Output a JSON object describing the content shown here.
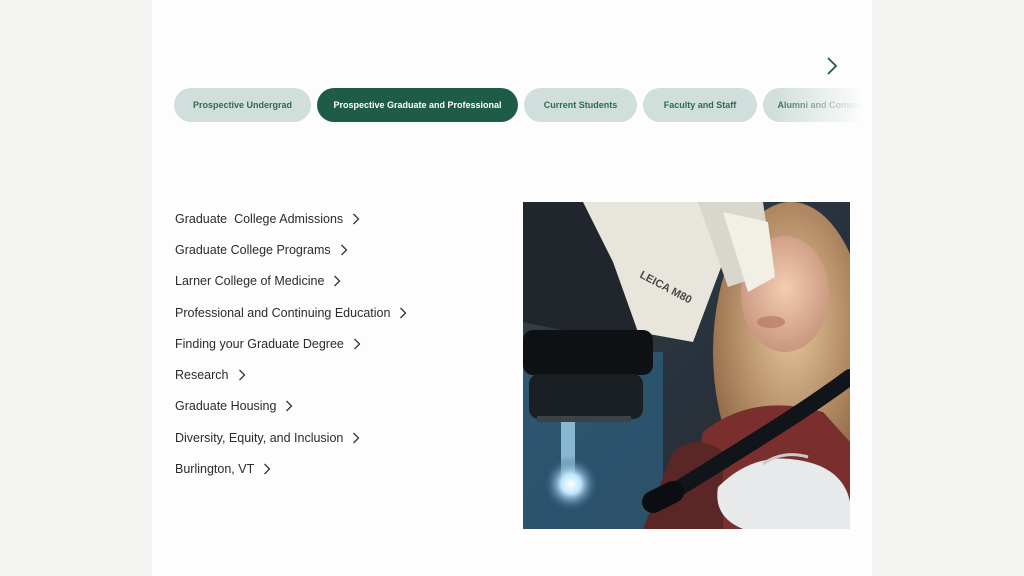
{
  "tabs": [
    {
      "label": "Prospective Undergrad"
    },
    {
      "label": "Prospective Graduate and Professional"
    },
    {
      "label": "Current Students"
    },
    {
      "label": "Faculty and Staff"
    },
    {
      "label": "Alumni and Community"
    }
  ],
  "links": [
    {
      "label": "Graduate  College Admissions"
    },
    {
      "label": "Graduate College Programs"
    },
    {
      "label": "Larner College of Medicine"
    },
    {
      "label": "Professional and Continuing Education"
    },
    {
      "label": "Finding your Graduate Degree"
    },
    {
      "label": "Research"
    },
    {
      "label": "Graduate Housing"
    },
    {
      "label": "Diversity, Equity, and Inclusion"
    },
    {
      "label": "Burlington, VT"
    }
  ],
  "photo": {
    "microscope_label": "LEICA M80"
  },
  "colors": {
    "accent": "#1f5c48",
    "tab_inactive_bg": "#d0dfdb",
    "tab_inactive_text": "#2d6a55",
    "page_bg": "#f4f4f3"
  },
  "icons": {
    "next": "chevron-right-icon",
    "link_arrow": "chevron-right-icon"
  }
}
